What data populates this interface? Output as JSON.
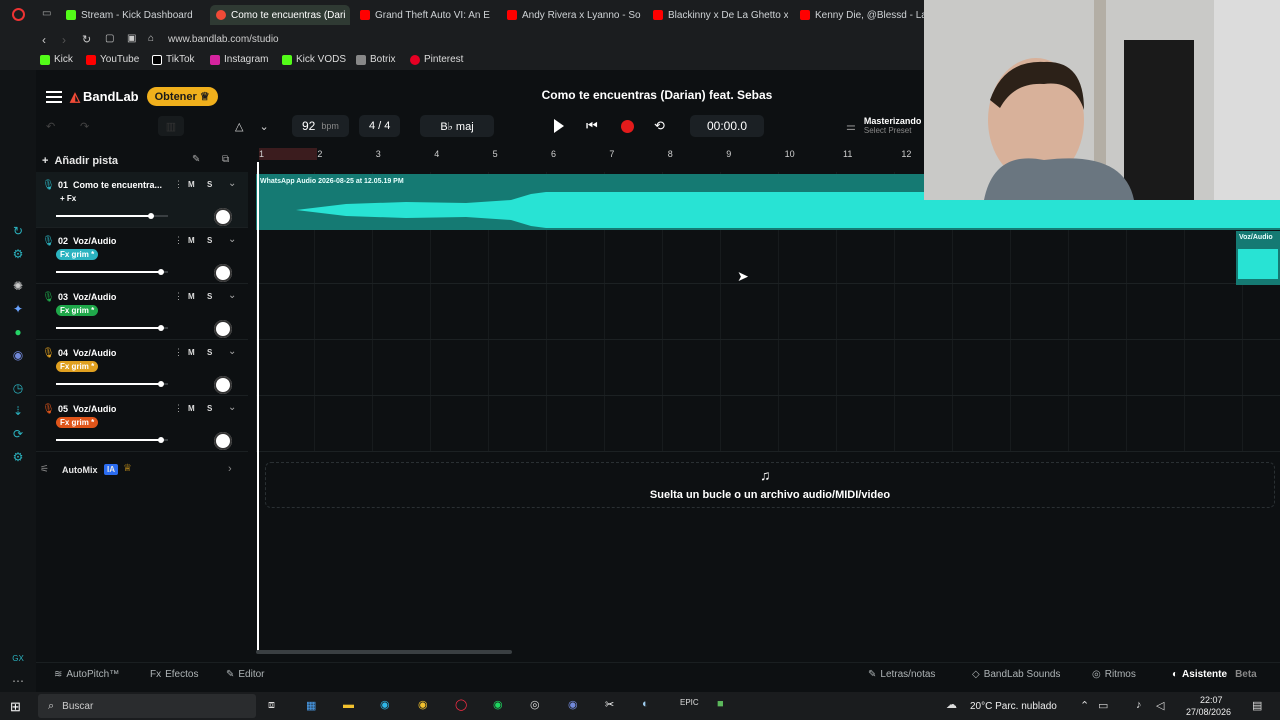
{
  "browser": {
    "tabs": [
      {
        "label": "Stream - Kick Dashboard",
        "color": "#53fc18"
      },
      {
        "label": "Como te encuentras (Dari",
        "color": "#f04b37",
        "active": true
      },
      {
        "label": "Grand Theft Auto VI: An E",
        "color": "#ff0000"
      },
      {
        "label": "Andy Rivera x Lyanno - So",
        "color": "#ff0000"
      },
      {
        "label": "Blackinny x De La Ghetto x",
        "color": "#ff0000"
      },
      {
        "label": "Kenny Die, @Blessd - Lad",
        "color": "#ff0000"
      }
    ],
    "url": "www.bandlab.com/studio",
    "bookmarks": [
      "Kick",
      "YouTube",
      "TikTok",
      "Instagram",
      "Kick VODS",
      "Botrix",
      "Pinterest"
    ]
  },
  "app": {
    "brand": "BandLab",
    "obtener": "Obtener",
    "title": "Como te encuentras (Darian) feat. Sebas",
    "bpm_value": "92",
    "bpm_unit": "bpm",
    "time_sig": "4 / 4",
    "key": "B♭ maj",
    "time": "00:00.0",
    "master_label": "Masterizando",
    "master_sub": "Select Preset",
    "add_track": "Añadir pista",
    "ruler": [
      "1",
      "2",
      "3",
      "4",
      "5",
      "6",
      "7",
      "8",
      "9",
      "10",
      "11",
      "12"
    ],
    "tracks": [
      {
        "num": "01",
        "name": "Como te encuentra...",
        "fx": "+ Fx",
        "fx_color": "",
        "mic_color": "#2bb3c0",
        "volume": 0.85
      },
      {
        "num": "02",
        "name": "Voz/Audio",
        "fx": "Fx grim *",
        "fx_color": "#2bb3c0",
        "mic_color": "#2bb3c0",
        "volume": 0.94
      },
      {
        "num": "03",
        "name": "Voz/Audio",
        "fx": "Fx grim *",
        "fx_color": "#1fa84a",
        "mic_color": "#1fa84a",
        "volume": 0.94
      },
      {
        "num": "04",
        "name": "Voz/Audio",
        "fx": "Fx grim *",
        "fx_color": "#e0a020",
        "mic_color": "#e0a020",
        "volume": 0.94
      },
      {
        "num": "05",
        "name": "Voz/Audio",
        "fx": "Fx grim *",
        "fx_color": "#e0551a",
        "mic_color": "#e0551a",
        "volume": 0.94
      }
    ],
    "ms_m": "M",
    "ms_s": "S",
    "automix": "AutoMix",
    "automix_badge": "IA",
    "clip_label": "WhatsApp Audio 2026-08-25 at 12.05.19 PM",
    "clip2_label": "Voz/Audio",
    "drop_text": "Suelta un bucle o un archivo audio/MIDI/video",
    "bottom": {
      "autopitch": "AutoPitch™",
      "efectos": "Efectos",
      "editor": "Editor",
      "letras": "Letras/notas",
      "sounds": "BandLab Sounds",
      "ritmos": "Ritmos",
      "asistente": "Asistente",
      "beta": "Beta"
    }
  },
  "taskbar": {
    "search": "Buscar",
    "weather": "20°C  Parc. nublado",
    "time": "22:07",
    "date": "27/08/2026"
  }
}
